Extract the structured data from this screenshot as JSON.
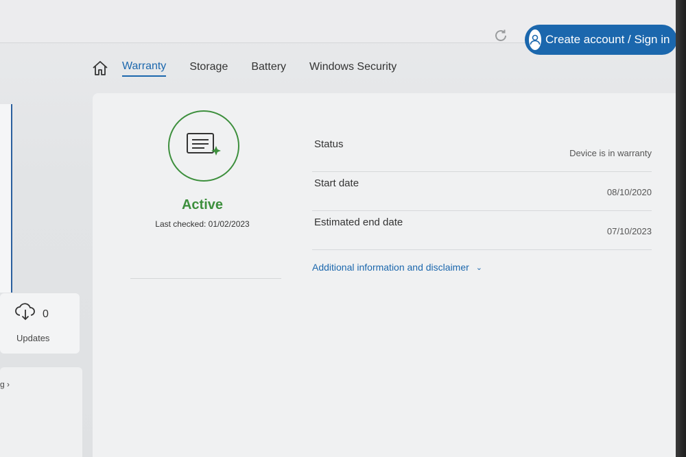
{
  "header": {
    "signin_label": "Create account / Sign in"
  },
  "icons": {
    "refresh": "refresh-icon",
    "user": "user-icon",
    "home": "home-icon",
    "cloud": "cloud-download-icon",
    "warranty": "warranty-document-icon"
  },
  "nav": {
    "tabs": [
      {
        "label": "Warranty",
        "active": true
      },
      {
        "label": "Storage",
        "active": false
      },
      {
        "label": "Battery",
        "active": false
      },
      {
        "label": "Windows Security",
        "active": false
      }
    ]
  },
  "sidebar": {
    "updates": {
      "count": "0",
      "label": "Updates"
    },
    "link_fragment": "g ›"
  },
  "warranty": {
    "state": "Active",
    "last_checked": "Last checked: 01/02/2023",
    "rows": [
      {
        "label": "Status",
        "value": "Device is in warranty"
      },
      {
        "label": "Start date",
        "value": "08/10/2020"
      },
      {
        "label": "Estimated end date",
        "value": "07/10/2023"
      }
    ],
    "disclaimer_label": "Additional information and disclaimer"
  },
  "colors": {
    "accent": "#1b67ad",
    "success": "#3d8f3d"
  }
}
